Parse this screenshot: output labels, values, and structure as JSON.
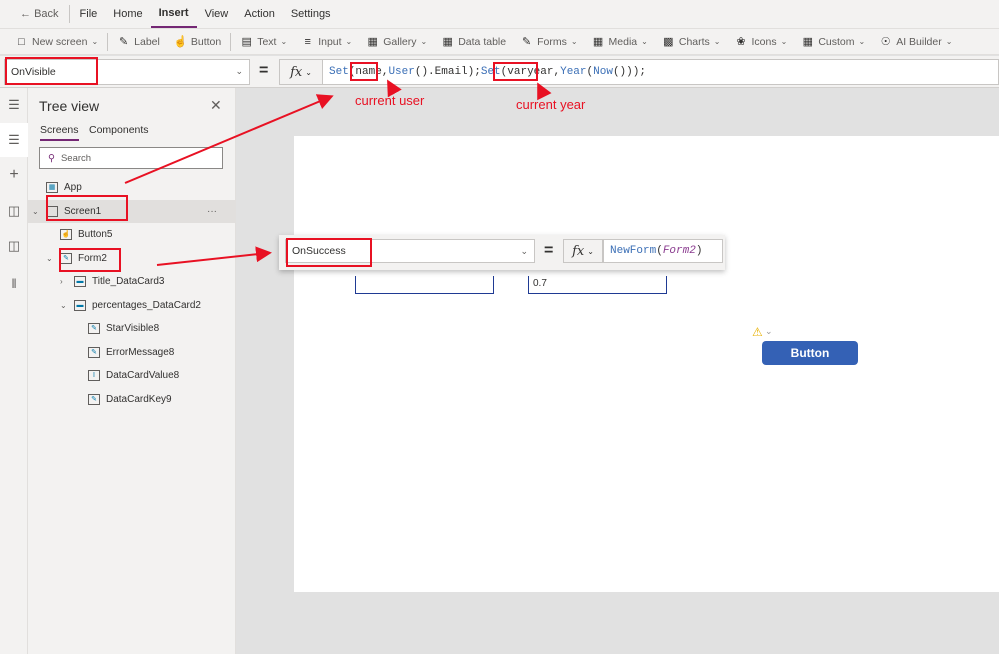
{
  "menu": {
    "back": "Back",
    "items": [
      "File",
      "Home",
      "Insert",
      "View",
      "Action",
      "Settings"
    ],
    "active": "Insert"
  },
  "toolbar": [
    {
      "label": "New screen",
      "icon": "new-screen-icon",
      "dropdown": true
    },
    {
      "label": "Label",
      "icon": "label-icon",
      "dropdown": false
    },
    {
      "label": "Button",
      "icon": "button-icon",
      "dropdown": false
    },
    {
      "label": "Text",
      "icon": "text-icon",
      "dropdown": true
    },
    {
      "label": "Input",
      "icon": "input-icon",
      "dropdown": true
    },
    {
      "label": "Gallery",
      "icon": "gallery-icon",
      "dropdown": true
    },
    {
      "label": "Data table",
      "icon": "data-table-icon",
      "dropdown": false
    },
    {
      "label": "Forms",
      "icon": "forms-icon",
      "dropdown": true
    },
    {
      "label": "Media",
      "icon": "media-icon",
      "dropdown": true
    },
    {
      "label": "Charts",
      "icon": "charts-icon",
      "dropdown": true
    },
    {
      "label": "Icons",
      "icon": "icons-icon",
      "dropdown": true
    },
    {
      "label": "Custom",
      "icon": "custom-icon",
      "dropdown": true
    },
    {
      "label": "AI Builder",
      "icon": "ai-builder-icon",
      "dropdown": true
    }
  ],
  "formula": {
    "property": "OnVisible",
    "eq": "=",
    "fx": "fx",
    "parts": [
      [
        "fn",
        "Set"
      ],
      [
        "p",
        "("
      ],
      [
        "p",
        "name"
      ],
      [
        "p",
        ","
      ],
      [
        "fn",
        "User"
      ],
      [
        "p",
        "().Email);"
      ],
      [
        "fn",
        "Set"
      ],
      [
        "p",
        "("
      ],
      [
        "p",
        "varyear"
      ],
      [
        "p",
        ","
      ],
      [
        "fn",
        "Year"
      ],
      [
        "p",
        "("
      ],
      [
        "fn",
        "Now"
      ],
      [
        "p",
        "()));"
      ]
    ]
  },
  "tree": {
    "title": "Tree view",
    "tabs": [
      "Screens",
      "Components"
    ],
    "search_placeholder": "Search",
    "nodes": [
      {
        "label": "App",
        "level": 0,
        "icon": "app-icon"
      },
      {
        "label": "Screen1",
        "level": 0,
        "icon": "screen-icon",
        "expanded": true,
        "selected": true
      },
      {
        "label": "Button5",
        "level": 1,
        "icon": "button-icon"
      },
      {
        "label": "Form2",
        "level": 1,
        "icon": "form-icon",
        "expanded": true
      },
      {
        "label": "Title_DataCard3",
        "level": 2,
        "icon": "datacard-icon",
        "expanded": false
      },
      {
        "label": "percentages_DataCard2",
        "level": 2,
        "icon": "datacard-icon",
        "expanded": true
      },
      {
        "label": "StarVisible8",
        "level": 3,
        "icon": "label-icon"
      },
      {
        "label": "ErrorMessage8",
        "level": 3,
        "icon": "label-icon"
      },
      {
        "label": "DataCardValue8",
        "level": 3,
        "icon": "text-input-icon"
      },
      {
        "label": "DataCardKey9",
        "level": 3,
        "icon": "label-icon"
      }
    ],
    "more": "···"
  },
  "popup": {
    "property": "OnSuccess",
    "eq": "=",
    "fx": "fx",
    "fn": "NewForm",
    "arg": "Form2"
  },
  "canvas": {
    "field_value": "0.7",
    "button_label": "Button"
  },
  "annotations": {
    "user": "current user",
    "year": "current year"
  },
  "colors": {
    "accent": "#742774",
    "annotation": "#e81123",
    "button": "#3461b5"
  }
}
